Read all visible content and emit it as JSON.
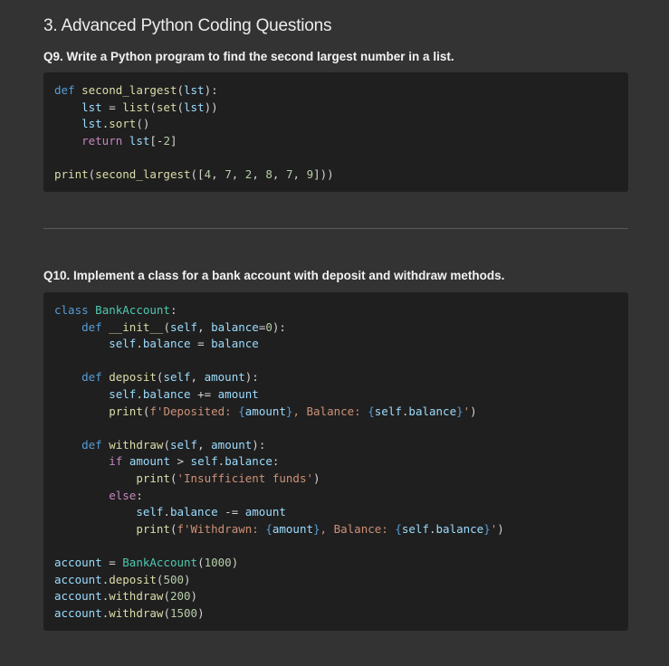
{
  "section": {
    "title": "3. Advanced Python Coding Questions"
  },
  "questions": [
    {
      "label": "Q9. Write a Python program to find the second largest number in a list.",
      "code_lines": [
        [
          {
            "t": "def",
            "c": "kw"
          },
          {
            "t": " ",
            "c": "pl"
          },
          {
            "t": "second_largest",
            "c": "fn"
          },
          {
            "t": "(",
            "c": "pl"
          },
          {
            "t": "lst",
            "c": "var"
          },
          {
            "t": "):",
            "c": "pl"
          }
        ],
        [
          {
            "t": "    ",
            "c": "pl"
          },
          {
            "t": "lst",
            "c": "var"
          },
          {
            "t": " = ",
            "c": "pl"
          },
          {
            "t": "list",
            "c": "fn"
          },
          {
            "t": "(",
            "c": "pl"
          },
          {
            "t": "set",
            "c": "fn"
          },
          {
            "t": "(",
            "c": "pl"
          },
          {
            "t": "lst",
            "c": "var"
          },
          {
            "t": "))",
            "c": "pl"
          }
        ],
        [
          {
            "t": "    ",
            "c": "pl"
          },
          {
            "t": "lst",
            "c": "var"
          },
          {
            "t": ".",
            "c": "pl"
          },
          {
            "t": "sort",
            "c": "fn"
          },
          {
            "t": "()",
            "c": "pl"
          }
        ],
        [
          {
            "t": "    ",
            "c": "pl"
          },
          {
            "t": "return",
            "c": "ctl"
          },
          {
            "t": " ",
            "c": "pl"
          },
          {
            "t": "lst",
            "c": "var"
          },
          {
            "t": "[-",
            "c": "pl"
          },
          {
            "t": "2",
            "c": "num"
          },
          {
            "t": "]",
            "c": "pl"
          }
        ],
        [],
        [
          {
            "t": "print",
            "c": "fn"
          },
          {
            "t": "(",
            "c": "pl"
          },
          {
            "t": "second_largest",
            "c": "fn"
          },
          {
            "t": "([",
            "c": "pl"
          },
          {
            "t": "4",
            "c": "num"
          },
          {
            "t": ", ",
            "c": "pl"
          },
          {
            "t": "7",
            "c": "num"
          },
          {
            "t": ", ",
            "c": "pl"
          },
          {
            "t": "2",
            "c": "num"
          },
          {
            "t": ", ",
            "c": "pl"
          },
          {
            "t": "8",
            "c": "num"
          },
          {
            "t": ", ",
            "c": "pl"
          },
          {
            "t": "7",
            "c": "num"
          },
          {
            "t": ", ",
            "c": "pl"
          },
          {
            "t": "9",
            "c": "num"
          },
          {
            "t": "]))",
            "c": "pl"
          }
        ]
      ]
    },
    {
      "label": "Q10. Implement a class for a bank account with deposit and withdraw methods.",
      "code_lines": [
        [
          {
            "t": "class",
            "c": "kw"
          },
          {
            "t": " ",
            "c": "pl"
          },
          {
            "t": "BankAccount",
            "c": "cls"
          },
          {
            "t": ":",
            "c": "pl"
          }
        ],
        [
          {
            "t": "    ",
            "c": "pl"
          },
          {
            "t": "def",
            "c": "kw"
          },
          {
            "t": " ",
            "c": "pl"
          },
          {
            "t": "__init__",
            "c": "fn"
          },
          {
            "t": "(",
            "c": "pl"
          },
          {
            "t": "self",
            "c": "var"
          },
          {
            "t": ", ",
            "c": "pl"
          },
          {
            "t": "balance",
            "c": "var"
          },
          {
            "t": "=",
            "c": "pl"
          },
          {
            "t": "0",
            "c": "num"
          },
          {
            "t": "):",
            "c": "pl"
          }
        ],
        [
          {
            "t": "        ",
            "c": "pl"
          },
          {
            "t": "self",
            "c": "var"
          },
          {
            "t": ".",
            "c": "pl"
          },
          {
            "t": "balance",
            "c": "var"
          },
          {
            "t": " = ",
            "c": "pl"
          },
          {
            "t": "balance",
            "c": "var"
          }
        ],
        [],
        [
          {
            "t": "    ",
            "c": "pl"
          },
          {
            "t": "def",
            "c": "kw"
          },
          {
            "t": " ",
            "c": "pl"
          },
          {
            "t": "deposit",
            "c": "fn"
          },
          {
            "t": "(",
            "c": "pl"
          },
          {
            "t": "self",
            "c": "var"
          },
          {
            "t": ", ",
            "c": "pl"
          },
          {
            "t": "amount",
            "c": "var"
          },
          {
            "t": "):",
            "c": "pl"
          }
        ],
        [
          {
            "t": "        ",
            "c": "pl"
          },
          {
            "t": "self",
            "c": "var"
          },
          {
            "t": ".",
            "c": "pl"
          },
          {
            "t": "balance",
            "c": "var"
          },
          {
            "t": " += ",
            "c": "pl"
          },
          {
            "t": "amount",
            "c": "var"
          }
        ],
        [
          {
            "t": "        ",
            "c": "pl"
          },
          {
            "t": "print",
            "c": "fn"
          },
          {
            "t": "(",
            "c": "pl"
          },
          {
            "t": "f'Deposited: ",
            "c": "str"
          },
          {
            "t": "{",
            "c": "kw"
          },
          {
            "t": "amount",
            "c": "var"
          },
          {
            "t": "}",
            "c": "kw"
          },
          {
            "t": ", Balance: ",
            "c": "str"
          },
          {
            "t": "{",
            "c": "kw"
          },
          {
            "t": "self",
            "c": "var"
          },
          {
            "t": ".",
            "c": "pl"
          },
          {
            "t": "balance",
            "c": "var"
          },
          {
            "t": "}",
            "c": "kw"
          },
          {
            "t": "'",
            "c": "str"
          },
          {
            "t": ")",
            "c": "pl"
          }
        ],
        [],
        [
          {
            "t": "    ",
            "c": "pl"
          },
          {
            "t": "def",
            "c": "kw"
          },
          {
            "t": " ",
            "c": "pl"
          },
          {
            "t": "withdraw",
            "c": "fn"
          },
          {
            "t": "(",
            "c": "pl"
          },
          {
            "t": "self",
            "c": "var"
          },
          {
            "t": ", ",
            "c": "pl"
          },
          {
            "t": "amount",
            "c": "var"
          },
          {
            "t": "):",
            "c": "pl"
          }
        ],
        [
          {
            "t": "        ",
            "c": "pl"
          },
          {
            "t": "if",
            "c": "ctl"
          },
          {
            "t": " ",
            "c": "pl"
          },
          {
            "t": "amount",
            "c": "var"
          },
          {
            "t": " > ",
            "c": "pl"
          },
          {
            "t": "self",
            "c": "var"
          },
          {
            "t": ".",
            "c": "pl"
          },
          {
            "t": "balance",
            "c": "var"
          },
          {
            "t": ":",
            "c": "pl"
          }
        ],
        [
          {
            "t": "            ",
            "c": "pl"
          },
          {
            "t": "print",
            "c": "fn"
          },
          {
            "t": "(",
            "c": "pl"
          },
          {
            "t": "'Insufficient funds'",
            "c": "str"
          },
          {
            "t": ")",
            "c": "pl"
          }
        ],
        [
          {
            "t": "        ",
            "c": "pl"
          },
          {
            "t": "else",
            "c": "ctl"
          },
          {
            "t": ":",
            "c": "pl"
          }
        ],
        [
          {
            "t": "            ",
            "c": "pl"
          },
          {
            "t": "self",
            "c": "var"
          },
          {
            "t": ".",
            "c": "pl"
          },
          {
            "t": "balance",
            "c": "var"
          },
          {
            "t": " -= ",
            "c": "pl"
          },
          {
            "t": "amount",
            "c": "var"
          }
        ],
        [
          {
            "t": "            ",
            "c": "pl"
          },
          {
            "t": "print",
            "c": "fn"
          },
          {
            "t": "(",
            "c": "pl"
          },
          {
            "t": "f'Withdrawn: ",
            "c": "str"
          },
          {
            "t": "{",
            "c": "kw"
          },
          {
            "t": "amount",
            "c": "var"
          },
          {
            "t": "}",
            "c": "kw"
          },
          {
            "t": ", Balance: ",
            "c": "str"
          },
          {
            "t": "{",
            "c": "kw"
          },
          {
            "t": "self",
            "c": "var"
          },
          {
            "t": ".",
            "c": "pl"
          },
          {
            "t": "balance",
            "c": "var"
          },
          {
            "t": "}",
            "c": "kw"
          },
          {
            "t": "'",
            "c": "str"
          },
          {
            "t": ")",
            "c": "pl"
          }
        ],
        [],
        [
          {
            "t": "account",
            "c": "var"
          },
          {
            "t": " = ",
            "c": "pl"
          },
          {
            "t": "BankAccount",
            "c": "cls"
          },
          {
            "t": "(",
            "c": "pl"
          },
          {
            "t": "1000",
            "c": "num"
          },
          {
            "t": ")",
            "c": "pl"
          }
        ],
        [
          {
            "t": "account",
            "c": "var"
          },
          {
            "t": ".",
            "c": "pl"
          },
          {
            "t": "deposit",
            "c": "fn"
          },
          {
            "t": "(",
            "c": "pl"
          },
          {
            "t": "500",
            "c": "num"
          },
          {
            "t": ")",
            "c": "pl"
          }
        ],
        [
          {
            "t": "account",
            "c": "var"
          },
          {
            "t": ".",
            "c": "pl"
          },
          {
            "t": "withdraw",
            "c": "fn"
          },
          {
            "t": "(",
            "c": "pl"
          },
          {
            "t": "200",
            "c": "num"
          },
          {
            "t": ")",
            "c": "pl"
          }
        ],
        [
          {
            "t": "account",
            "c": "var"
          },
          {
            "t": ".",
            "c": "pl"
          },
          {
            "t": "withdraw",
            "c": "fn"
          },
          {
            "t": "(",
            "c": "pl"
          },
          {
            "t": "1500",
            "c": "num"
          },
          {
            "t": ")",
            "c": "pl"
          }
        ]
      ]
    }
  ],
  "colors": {
    "background": "#333333",
    "code_background": "#1f1f1f",
    "keyword": "#569cd6",
    "control": "#c586c0",
    "function": "#dcdcaa",
    "variable": "#9cdcfe",
    "class": "#4ec9b0",
    "number": "#b5cea8",
    "string": "#ce9178"
  }
}
